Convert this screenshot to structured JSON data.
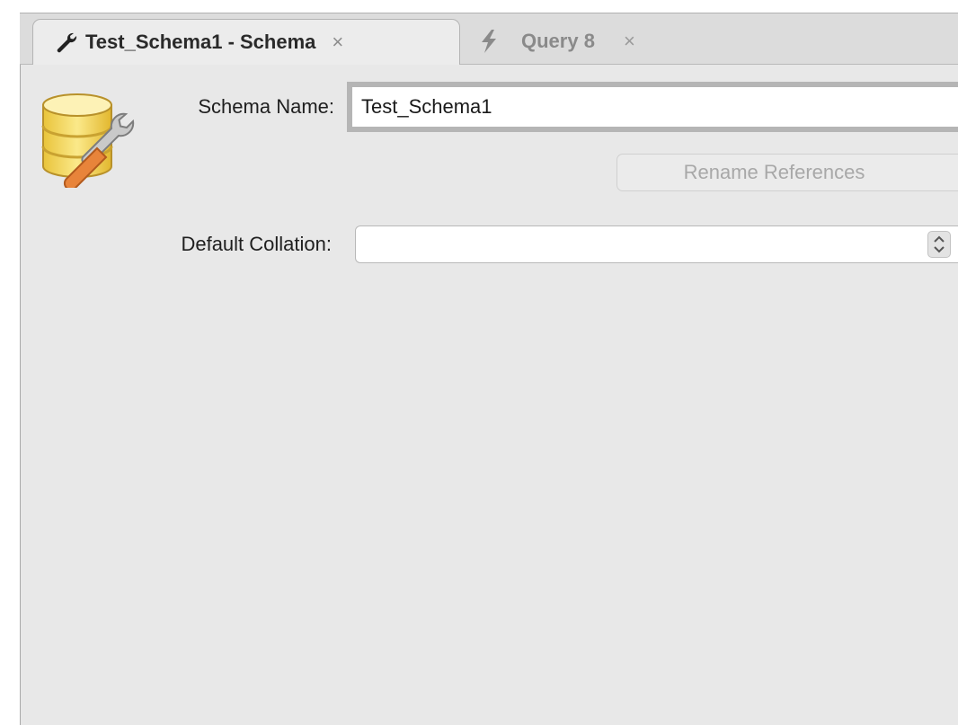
{
  "tabs": [
    {
      "label": "Test_Schema1 - Schema",
      "icon": "wrench-icon",
      "close": "×",
      "active": true
    },
    {
      "label": "Query 8",
      "icon": "lightning-icon",
      "close": "×",
      "active": false
    }
  ],
  "form": {
    "schema_name_label": "Schema Name:",
    "schema_name_value": "Test_Schema1",
    "rename_references_label": "Rename References",
    "default_collation_label": "Default Collation:",
    "default_collation_value": ""
  },
  "icons": {
    "schema": "database-wrench-icon"
  },
  "colors": {
    "background": "#e8e8e8",
    "disabled_text": "#a8a8a8",
    "database_icon_yellow": "#f3d35a",
    "wrench_orange": "#e8843a"
  }
}
